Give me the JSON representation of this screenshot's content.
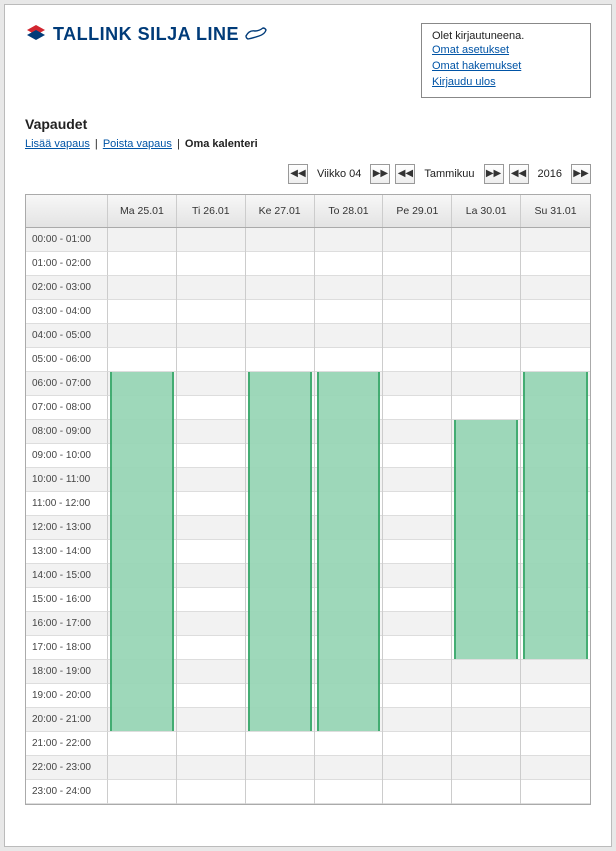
{
  "logo_text": "TALLINK SILJA LINE",
  "login": {
    "status": "Olet kirjautuneena.",
    "settings": "Omat asetukset",
    "applications": "Omat hakemukset",
    "logout": "Kirjaudu ulos"
  },
  "title": "Vapaudet",
  "links": {
    "add": "Lisää vapaus",
    "remove": "Poista vapaus",
    "own": "Oma kalenteri"
  },
  "nav": {
    "week": "Viikko 04",
    "month": "Tammikuu",
    "year": "2016"
  },
  "days": [
    "Ma 25.01",
    "Ti 26.01",
    "Ke 27.01",
    "To 28.01",
    "Pe 29.01",
    "La 30.01",
    "Su 31.01"
  ],
  "hours": [
    "00:00 - 01:00",
    "01:00 - 02:00",
    "02:00 - 03:00",
    "03:00 - 04:00",
    "04:00 - 05:00",
    "05:00 - 06:00",
    "06:00 - 07:00",
    "07:00 - 08:00",
    "08:00 - 09:00",
    "09:00 - 10:00",
    "10:00 - 11:00",
    "11:00 - 12:00",
    "12:00 - 13:00",
    "13:00 - 14:00",
    "14:00 - 15:00",
    "15:00 - 16:00",
    "16:00 - 17:00",
    "17:00 - 18:00",
    "18:00 - 19:00",
    "19:00 - 20:00",
    "20:00 - 21:00",
    "21:00 - 22:00",
    "22:00 - 23:00",
    "23:00 - 24:00"
  ],
  "events": [
    {
      "day": 0,
      "start": 6,
      "end": 21
    },
    {
      "day": 2,
      "start": 6,
      "end": 21
    },
    {
      "day": 3,
      "start": 6,
      "end": 21
    },
    {
      "day": 5,
      "start": 8,
      "end": 18
    },
    {
      "day": 6,
      "start": 6,
      "end": 18
    }
  ]
}
